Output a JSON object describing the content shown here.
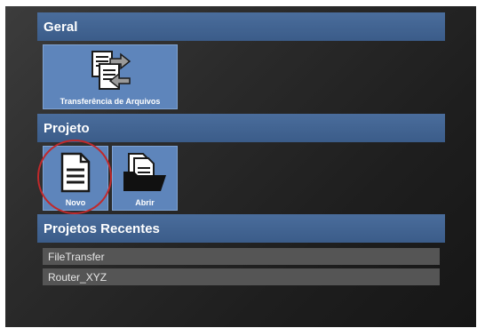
{
  "sections": {
    "geral": {
      "title": "Geral"
    },
    "projeto": {
      "title": "Projeto"
    },
    "recentes": {
      "title": "Projetos Recentes"
    }
  },
  "tiles": {
    "file_transfer": {
      "label": "Transferência de Arquivos",
      "icon": "file-transfer-icon"
    },
    "novo": {
      "label": "Novo",
      "icon": "new-document-icon"
    },
    "abrir": {
      "label": "Abrir",
      "icon": "open-folder-icon"
    }
  },
  "recent_projects": [
    "FileTransfer",
    "Router_XYZ"
  ],
  "colors": {
    "header": "#3b5c89",
    "tile": "#5e85bb",
    "recent_item": "#555555",
    "highlight": "#c0292b"
  }
}
